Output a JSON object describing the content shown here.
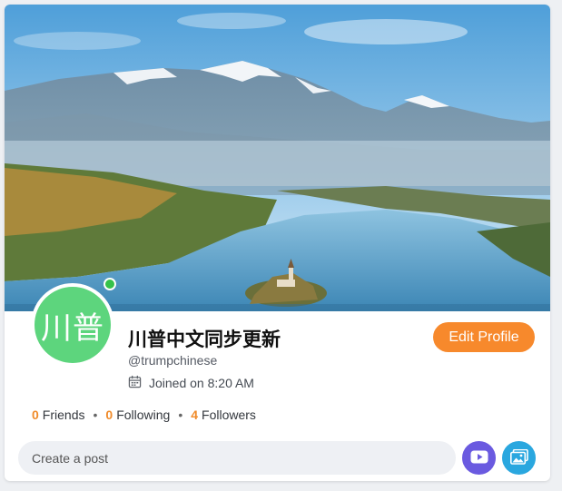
{
  "profile": {
    "display_name": "川普中文同步更新",
    "handle": "@trumpchinese",
    "joined": "Joined on 8:20 AM",
    "avatar_text": "川普",
    "online": true
  },
  "actions": {
    "edit_profile": "Edit Profile"
  },
  "stats": [
    {
      "count": "0",
      "label": "Friends"
    },
    {
      "count": "0",
      "label": "Following"
    },
    {
      "count": "4",
      "label": "Followers"
    }
  ],
  "stats_separator": "•",
  "composer": {
    "placeholder": "Create a post"
  },
  "icons": {
    "calendar": "calendar-icon",
    "video": "video-icon",
    "photo": "image-icon"
  },
  "colors": {
    "accent": "#f7892c",
    "avatar_bg": "#5dd57d",
    "online": "#35c24a",
    "video_btn": "#6a5ae0",
    "photo_btn": "#2aa7df"
  }
}
